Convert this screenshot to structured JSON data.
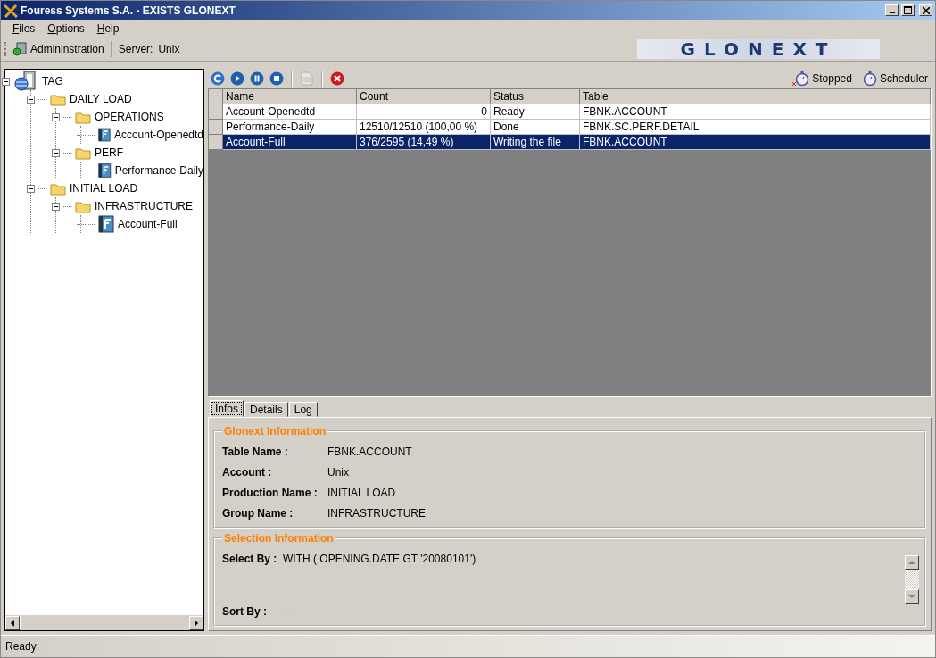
{
  "window": {
    "title": "Fouress Systems S.A. - EXISTS GLONEXT"
  },
  "menu": [
    {
      "label": "Files"
    },
    {
      "label": "Options"
    },
    {
      "label": "Help"
    }
  ],
  "toolbar": {
    "admin": "Admininstration",
    "server_label": "Server:",
    "server": "Unix",
    "logo": "GLONEXT"
  },
  "tree": [
    {
      "kind": "root",
      "label": "TAG",
      "expanded": true,
      "children": [
        {
          "kind": "folder",
          "label": "DAILY LOAD",
          "expanded": true,
          "children": [
            {
              "kind": "folder",
              "label": "OPERATIONS",
              "expanded": true,
              "children": [
                {
                  "kind": "job",
                  "label": "Account-Openedtd"
                }
              ]
            },
            {
              "kind": "folder",
              "label": "PERF",
              "expanded": true,
              "children": [
                {
                  "kind": "job",
                  "label": "Performance-Daily"
                }
              ]
            }
          ]
        },
        {
          "kind": "folder",
          "label": "INITIAL LOAD",
          "expanded": true,
          "children": [
            {
              "kind": "folder",
              "label": "INFRASTRUCTURE",
              "expanded": true,
              "children": [
                {
                  "kind": "job",
                  "label": "Account-Full"
                }
              ]
            }
          ]
        }
      ]
    }
  ],
  "actions": [
    {
      "kind": "refresh",
      "disabled": false
    },
    {
      "kind": "play",
      "disabled": false
    },
    {
      "kind": "pause",
      "disabled": false
    },
    {
      "kind": "stop",
      "disabled": false
    },
    {
      "kind": "separator"
    },
    {
      "kind": "document",
      "disabled": true
    },
    {
      "kind": "separator"
    },
    {
      "kind": "cancel",
      "disabled": false
    }
  ],
  "scheduler": [
    {
      "kind": "stopped",
      "label": "Stopped"
    },
    {
      "kind": "scheduler",
      "label": "Scheduler"
    }
  ],
  "table": {
    "columns": [
      "Name",
      "Count",
      "Status",
      "Table"
    ],
    "rows": [
      {
        "selected": false,
        "cells": [
          "Account-Openedtd",
          "0",
          "Ready",
          "FBNK.ACCOUNT"
        ]
      },
      {
        "selected": false,
        "cells": [
          "Performance-Daily",
          "12510/12510 (100,00 %)",
          "Done",
          "FBNK.SC.PERF.DETAIL"
        ]
      },
      {
        "selected": true,
        "cells": [
          "Account-Full",
          "376/2595 (14,49 %)",
          "Writing the file",
          "FBNK.ACCOUNT"
        ]
      }
    ]
  },
  "tabs": [
    {
      "label": "Infos",
      "selected": true
    },
    {
      "label": "Details",
      "selected": false
    },
    {
      "label": "Log",
      "selected": false
    }
  ],
  "groups": [
    {
      "title": "Glonext Information",
      "kind": "fields",
      "fields": [
        {
          "label": "Table Name :",
          "value": "FBNK.ACCOUNT"
        },
        {
          "label": "Account :",
          "value": "Unix"
        },
        {
          "label": "Production Name :",
          "value": "INITIAL LOAD"
        },
        {
          "label": "Group Name :",
          "value": "INFRASTRUCTURE"
        }
      ]
    },
    {
      "title": "Selection Information",
      "kind": "selection",
      "fields": [
        {
          "label": "Select By :",
          "value": "WITH ( OPENING.DATE GT '20080101')"
        },
        {
          "label": "Sort By :",
          "value": "-"
        }
      ]
    }
  ],
  "status_bar": "Ready"
}
